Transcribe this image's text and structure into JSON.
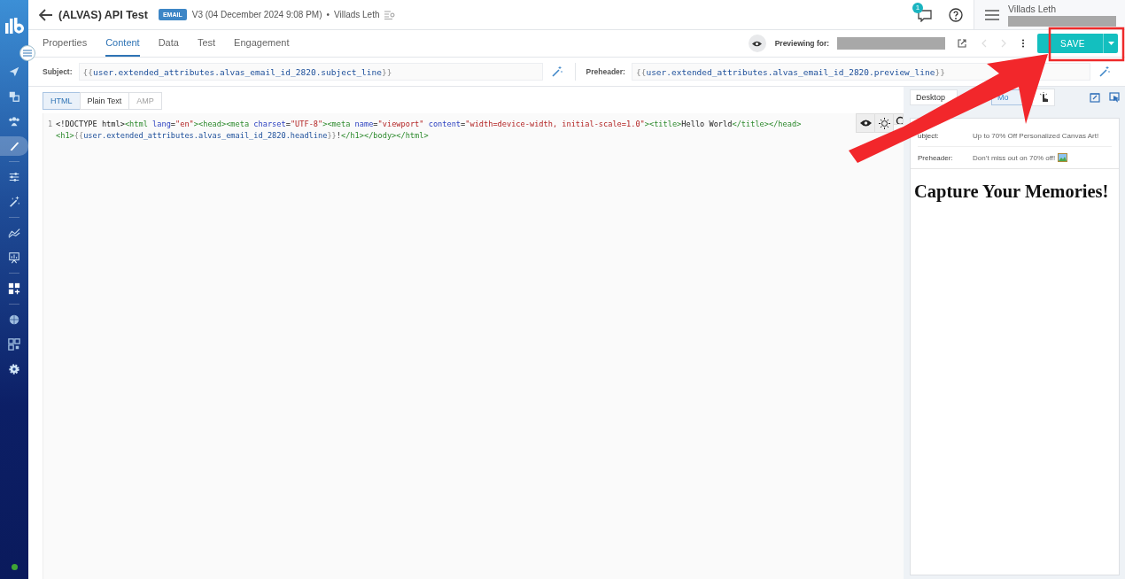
{
  "sidebar": {
    "items": [
      {
        "kind": "send",
        "selected": false
      },
      {
        "kind": "copy",
        "selected": false
      },
      {
        "kind": "people",
        "selected": false
      },
      {
        "kind": "brush",
        "selected": true
      },
      {
        "kind": "rule"
      },
      {
        "kind": "sliders",
        "selected": false
      },
      {
        "kind": "wand",
        "selected": false
      },
      {
        "kind": "rule"
      },
      {
        "kind": "chart",
        "selected": false
      },
      {
        "kind": "board",
        "selected": false
      },
      {
        "kind": "rule"
      },
      {
        "kind": "grid",
        "selected": false
      },
      {
        "kind": "rule"
      },
      {
        "kind": "globe",
        "selected": false
      },
      {
        "kind": "qr",
        "selected": false
      },
      {
        "kind": "gear",
        "selected": false
      }
    ]
  },
  "header": {
    "title": "(ALVAS) API Test",
    "badge": "EMAIL",
    "version": "V3 (04 December 2024 9:08 PM)",
    "separator": "•",
    "author": "Villads Leth",
    "notifications": "1",
    "user_name": "Villads Leth"
  },
  "tabs": [
    {
      "label": "Properties",
      "selected": false
    },
    {
      "label": "Content",
      "selected": true
    },
    {
      "label": "Data",
      "selected": false
    },
    {
      "label": "Test",
      "selected": false
    },
    {
      "label": "Engagement",
      "selected": false
    }
  ],
  "preview_bar": {
    "label": "Previewing for:",
    "save": "SAVE"
  },
  "fields": [
    {
      "label": "Subject:",
      "open": "{{",
      "value": "user.extended_attributes.alvas_email_id_2820.subject_line",
      "close": "}}"
    },
    {
      "label": "Preheader:",
      "open": "{{",
      "value": "user.extended_attributes.alvas_email_id_2820.preview_line",
      "close": "}}"
    }
  ],
  "format_tabs": [
    {
      "label": "HTML",
      "selected": true,
      "disabled": false
    },
    {
      "label": "Plain Text",
      "selected": false,
      "disabled": false
    },
    {
      "label": "AMP",
      "selected": false,
      "disabled": true
    }
  ],
  "editor": {
    "line_number": "1",
    "lines": [
      [
        {
          "kind": "text",
          "s": "<!DOCTYPE html>"
        },
        {
          "kind": "tag",
          "s": "<html"
        },
        {
          "kind": "attr",
          "s": " lang"
        },
        {
          "kind": "text",
          "s": "="
        },
        {
          "kind": "str",
          "s": "\"en\""
        },
        {
          "kind": "tag",
          "s": "><head><meta"
        },
        {
          "kind": "attr",
          "s": " charset"
        },
        {
          "kind": "text",
          "s": "="
        },
        {
          "kind": "str",
          "s": "\"UTF-8\""
        },
        {
          "kind": "tag",
          "s": "><meta"
        },
        {
          "kind": "attr",
          "s": " name"
        },
        {
          "kind": "text",
          "s": "="
        },
        {
          "kind": "str",
          "s": "\"viewport\""
        },
        {
          "kind": "attr",
          "s": " content"
        },
        {
          "kind": "text",
          "s": "="
        },
        {
          "kind": "str",
          "s": "\"width=device-width, initial-scale=1.0\""
        },
        {
          "kind": "tag",
          "s": "><title>"
        },
        {
          "kind": "text",
          "s": "Hello World"
        },
        {
          "kind": "tag",
          "s": "</title></head>"
        }
      ],
      [
        {
          "kind": "tag",
          "s": "<h1>"
        },
        {
          "kind": "brace",
          "s": "{{"
        },
        {
          "kind": "var",
          "s": "user.extended_attributes.alvas_email_id_2820.headline"
        },
        {
          "kind": "brace",
          "s": "}}"
        },
        {
          "kind": "text",
          "s": "!"
        },
        {
          "kind": "tag",
          "s": "</h1></body></html>"
        }
      ]
    ]
  },
  "preview": {
    "modes": [
      {
        "label": "Desktop",
        "selected": false
      },
      {
        "label": "Mo",
        "selected": true
      }
    ],
    "rows": [
      {
        "label": "ubject:",
        "value": "Up to 70% Off Personalized Canvas Art!",
        "image": false
      },
      {
        "label": "Preheader:",
        "value": "Don’t miss out on 70% off!",
        "image": true
      }
    ],
    "headline": "Capture Your Memories!"
  }
}
